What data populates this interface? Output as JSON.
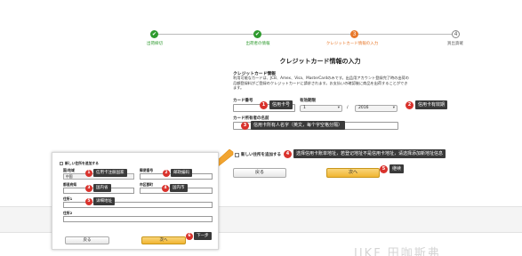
{
  "steps": [
    {
      "label": "出荷締切",
      "state": "done",
      "icon": "✔"
    },
    {
      "label": "出荷者の情報",
      "state": "done",
      "icon": "✔"
    },
    {
      "label": "クレジットカード情報の入力",
      "state": "active",
      "icon": "3"
    },
    {
      "label": "買出貨確",
      "state": "todo",
      "icon": "4"
    }
  ],
  "page_title": "クレジットカード情報の入力",
  "info": {
    "heading": "クレジットカード情報",
    "body": "利用可能なカードは、JCB、Amex、Visa、MasterCardのみです。出品用アカウント登録完了時の出荷の月額登録料がご登録のクレジットカードに請求されます。お支払いの確認後に商品を出荷することができます。"
  },
  "form": {
    "card_number_label": "カード番号",
    "expiry_label": "有効期限",
    "expiry_month": "1",
    "expiry_slash": "/",
    "expiry_year": "2016",
    "holder_label": "カード所有者の名前",
    "new_address_label": "新しい住所を追加する",
    "back_button": "戻る",
    "next_button": "次へ"
  },
  "annotations": {
    "card_number": {
      "num": "1",
      "text": "信用卡号"
    },
    "expiry": {
      "num": "2",
      "text": "信用卡有效期"
    },
    "holder": {
      "num": "3",
      "text": "信用卡所有人名字（英文，每个字空格分隔）"
    },
    "address": {
      "num": "4",
      "text": "选择信用卡账单地址，若登记地址不是信用卡地址，请选择添加新地址信息"
    },
    "next": {
      "num": "5",
      "text": "继续"
    }
  },
  "zoom_panel": {
    "checkbox_label": "新しい住所を追加する",
    "country_label": "国/地域",
    "country_value": "中国",
    "postal_label": "郵便番号",
    "prefecture_label": "都道府県",
    "city_label": "市区郡町",
    "address1_label": "住所1",
    "address2_label": "住所2",
    "back_button": "戻る",
    "next_button": "次へ",
    "notes": [
      {
        "num": "1",
        "text": "信用卡注册国家"
      },
      {
        "num": "2",
        "text": "邮政编码"
      },
      {
        "num": "3",
        "text": "国内省"
      },
      {
        "num": "4",
        "text": "国内市"
      },
      {
        "num": "5",
        "text": "详细地址"
      },
      {
        "num": "6",
        "text": "下一步"
      }
    ]
  },
  "watermark": "IIKF 田咖斯弗",
  "colors": {
    "done": "#2e9a2e",
    "active": "#e8782a",
    "badge": "#d9322c",
    "tag": "#3a3a3a",
    "arrow": "#f2a531",
    "next_button": "#f1b531"
  }
}
